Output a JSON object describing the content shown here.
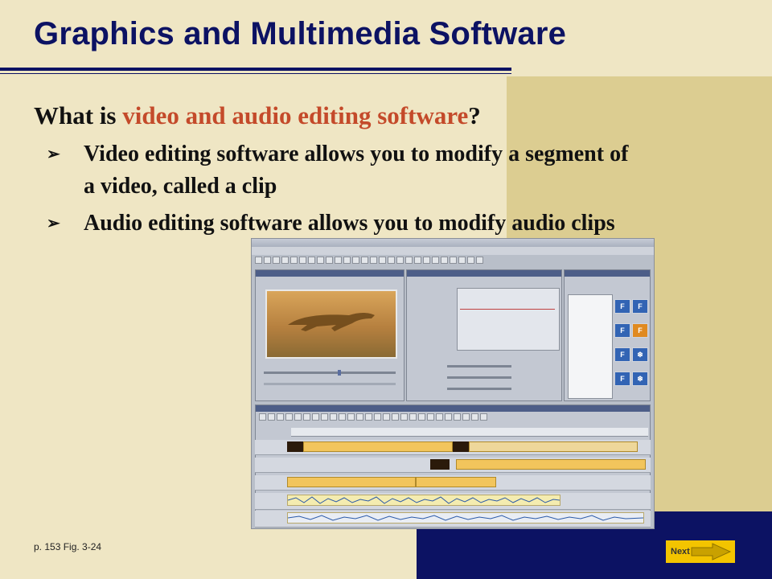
{
  "slide": {
    "title": "Graphics and Multimedia Software",
    "question": {
      "prefix": "What is ",
      "highlight": "video and audio editing software",
      "suffix": "?"
    },
    "bullets": [
      "Video editing software allows you to modify a segment of a video, called a clip",
      "Audio editing software allows you to modify audio clips"
    ],
    "reference": "p. 153 Fig. 3-24",
    "next_label": "Next"
  },
  "colors": {
    "navy": "#0c1263",
    "highlight": "#c44a2a",
    "tan_panel": "#dccd91",
    "background": "#efe6c4",
    "next_button": "#f3c400"
  }
}
